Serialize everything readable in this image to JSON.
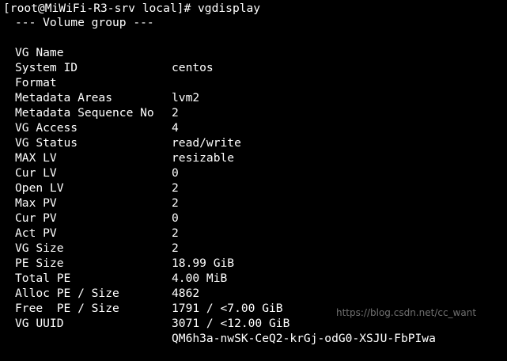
{
  "terminal": {
    "prompt": "[root@MiWiFi-R3-srv local]# ",
    "command": "vgdisplay",
    "header": "--- Volume group ---",
    "rows": [
      {
        "key": "VG Name",
        "value": "centos"
      },
      {
        "key": "System ID",
        "value": ""
      },
      {
        "key": "Format",
        "value": "lvm2"
      },
      {
        "key": "Metadata Areas",
        "value": "2"
      },
      {
        "key": "Metadata Sequence No",
        "value": "4"
      },
      {
        "key": "VG Access",
        "value": "read/write"
      },
      {
        "key": "VG Status",
        "value": "resizable"
      },
      {
        "key": "MAX LV",
        "value": "0"
      },
      {
        "key": "Cur LV",
        "value": "2"
      },
      {
        "key": "Open LV",
        "value": "2"
      },
      {
        "key": "Max PV",
        "value": "0"
      },
      {
        "key": "Cur PV",
        "value": "2"
      },
      {
        "key": "Act PV",
        "value": "2"
      },
      {
        "key": "VG Size",
        "value": "18.99 GiB"
      },
      {
        "key": "PE Size",
        "value": "4.00 MiB"
      },
      {
        "key": "Total PE",
        "value": "4862"
      },
      {
        "key": "Alloc PE / Size",
        "value": "1791 / <7.00 GiB"
      },
      {
        "key": "Free  PE / Size",
        "value": "3071 / <12.00 GiB"
      },
      {
        "key": "VG UUID",
        "value": "QM6h3a-nwSK-CeQ2-krGj-odG0-XSJU-FbPIwa"
      }
    ],
    "colors": {
      "background": "#000000",
      "foreground": "#ffffff"
    }
  },
  "watermark": "https://blog.csdn.net/cc_want"
}
